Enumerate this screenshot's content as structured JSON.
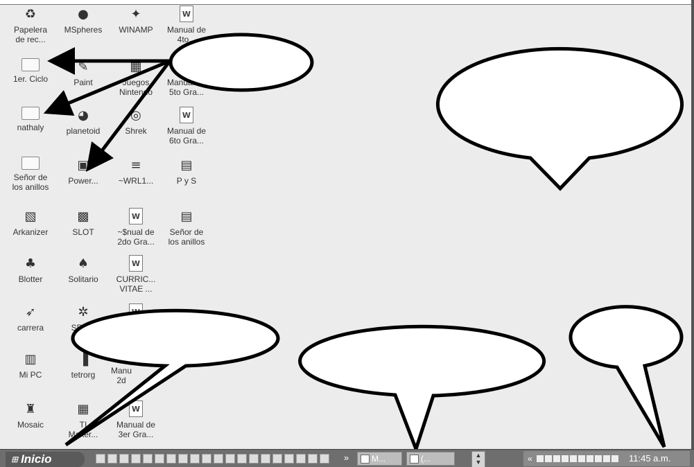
{
  "desktop": {
    "icons": [
      {
        "glyph": "♻",
        "label1": "Papelera",
        "label2": "de rec..."
      },
      {
        "glyph": "●",
        "label1": "MSpheres",
        "label2": ""
      },
      {
        "glyph": "✦",
        "label1": "WINAMP",
        "label2": ""
      },
      {
        "glyph": "W",
        "label1": "Manual de",
        "label2": "4to..."
      },
      {
        "glyph": "",
        "label1": "1er. Ciclo",
        "label2": ""
      },
      {
        "glyph": "✎",
        "label1": "Paint",
        "label2": ""
      },
      {
        "glyph": "▦",
        "label1": "Juegos",
        "label2": "Nintendo"
      },
      {
        "glyph": "W",
        "label1": "Manual de",
        "label2": "5to Gra..."
      },
      {
        "glyph": "",
        "label1": "nathaly",
        "label2": ""
      },
      {
        "glyph": "◕",
        "label1": "planetoid",
        "label2": ""
      },
      {
        "glyph": "◎",
        "label1": "Shrek",
        "label2": ""
      },
      {
        "glyph": "W",
        "label1": "Manual de",
        "label2": "6to Gra..."
      },
      {
        "glyph": "",
        "label1": "Señor de",
        "label2": "los anillos"
      },
      {
        "glyph": "▣",
        "label1": "Power...",
        "label2": ""
      },
      {
        "glyph": "≡",
        "label1": "~WRL1...",
        "label2": ""
      },
      {
        "glyph": "▤",
        "label1": "P y S",
        "label2": ""
      },
      {
        "glyph": "▧",
        "label1": "Arkanizer",
        "label2": ""
      },
      {
        "glyph": "▩",
        "label1": "SLOT",
        "label2": ""
      },
      {
        "glyph": "W",
        "label1": "~$nual de",
        "label2": "2do Gra..."
      },
      {
        "glyph": "▤",
        "label1": "Señor de",
        "label2": "los anillos"
      },
      {
        "glyph": "♣",
        "label1": "Blotter",
        "label2": ""
      },
      {
        "glyph": "♠",
        "label1": "Solitario",
        "label2": ""
      },
      {
        "glyph": "W",
        "label1": "CURRIC...",
        "label2": "VITAE ..."
      },
      {
        "glyph": "➶",
        "label1": "carrera",
        "label2": ""
      },
      {
        "glyph": "✲",
        "label1": "SPball",
        "label2": ""
      },
      {
        "glyph": "W",
        "label1": "",
        "label2": ""
      },
      {
        "glyph": "▥",
        "label1": "Mi PC",
        "label2": ""
      },
      {
        "glyph": "▐",
        "label1": "tetrorg",
        "label2": ""
      },
      {
        "glyph": "",
        "label1": "Manu",
        "label2": "2d"
      },
      {
        "glyph": "♜",
        "label1": "Mosaic",
        "label2": ""
      },
      {
        "glyph": "▦",
        "label1": "TI",
        "label2": "Maker..."
      },
      {
        "glyph": "W",
        "label1": "Manual de",
        "label2": "3er Gra..."
      }
    ]
  },
  "taskbar": {
    "start_label": "Inicio",
    "start_glyph": "⊞",
    "tasks": [
      {
        "label": "M..."
      },
      {
        "label": "(..."
      }
    ],
    "scroll_up": "▲",
    "scroll_down": "▼",
    "chevron": "»",
    "tray_chevron": "«",
    "clock": "11:45 a.m."
  }
}
